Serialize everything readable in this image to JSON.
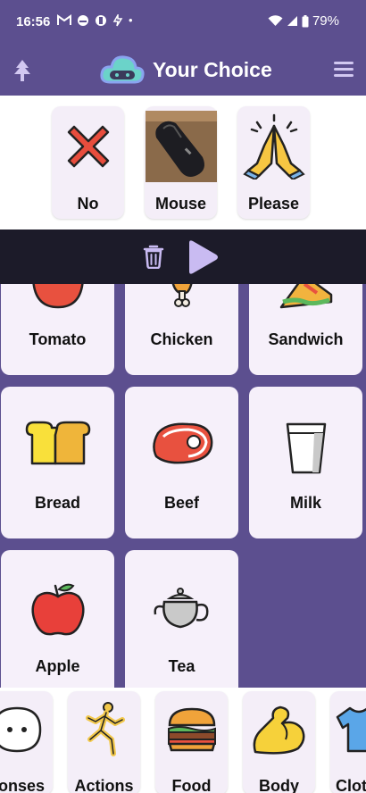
{
  "status": {
    "time": "16:56",
    "battery": "79%",
    "notif_icons": [
      "gmail-icon",
      "app-icon",
      "app2-icon",
      "voice-icon"
    ],
    "dot": "•"
  },
  "app": {
    "title": "Your Choice",
    "accent": "#5c4f8f"
  },
  "sentence": {
    "items": [
      {
        "label": "No",
        "icon": "cross-icon"
      },
      {
        "label": "Mouse",
        "icon": "mouse-photo"
      },
      {
        "label": "Please",
        "icon": "praying-hands-icon"
      }
    ]
  },
  "grid": {
    "tiles": [
      {
        "label": "Tomato",
        "icon": "tomato-icon"
      },
      {
        "label": "Chicken",
        "icon": "chicken-leg-icon"
      },
      {
        "label": "Sandwich",
        "icon": "sandwich-icon"
      },
      {
        "label": "Bread",
        "icon": "bread-icon"
      },
      {
        "label": "Beef",
        "icon": "beef-icon"
      },
      {
        "label": "Milk",
        "icon": "milk-icon"
      },
      {
        "label": "Apple",
        "icon": "apple-icon"
      },
      {
        "label": "Tea",
        "icon": "teapot-icon"
      }
    ]
  },
  "categories": [
    {
      "label": "ponses",
      "icon": "speech-bubble-icon"
    },
    {
      "label": "Actions",
      "icon": "running-person-icon"
    },
    {
      "label": "Food",
      "icon": "burger-icon"
    },
    {
      "label": "Body",
      "icon": "flexed-arm-icon"
    },
    {
      "label": "Clot",
      "icon": "shirt-icon"
    }
  ]
}
